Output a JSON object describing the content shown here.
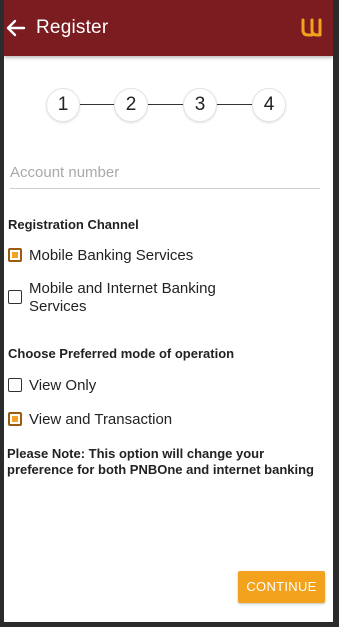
{
  "appbar": {
    "title": "Register",
    "back_icon": "arrow-left-icon",
    "logo_icon": "pnb-logo-icon"
  },
  "stepper": {
    "steps": [
      "1",
      "2",
      "3",
      "4"
    ]
  },
  "account": {
    "placeholder": "Account number",
    "value": ""
  },
  "registration_channel": {
    "label": "Registration Channel",
    "options": [
      {
        "label": "Mobile Banking Services",
        "checked": true
      },
      {
        "label_line1": "Mobile and Internet Banking",
        "label_line2": "Services",
        "checked": false
      }
    ]
  },
  "mode": {
    "label": "Choose Preferred mode of operation",
    "options": [
      {
        "label": "View Only",
        "checked": false
      },
      {
        "label": "View and Transaction",
        "checked": true
      }
    ]
  },
  "note": {
    "line1": "Please Note: This option will change your",
    "line2": "preference for both PNBOne and internet banking"
  },
  "continue_label": "CONTINUE",
  "colors": {
    "appbar": "#7a1c20",
    "accent": "#f2a21c"
  }
}
